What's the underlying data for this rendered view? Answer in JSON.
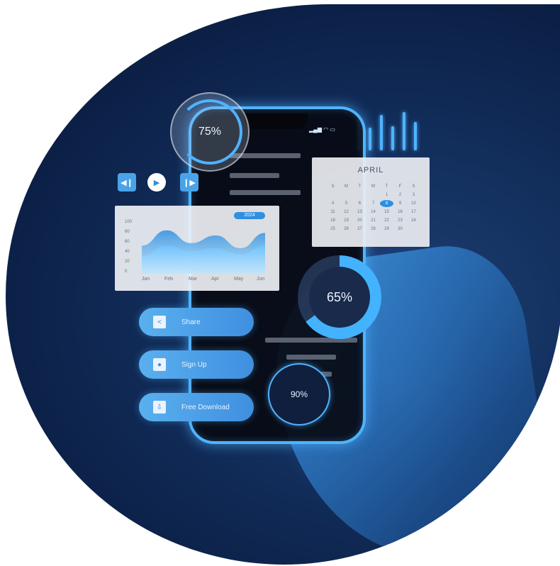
{
  "rings": {
    "r75": "75%",
    "r65": "65%",
    "r90": "90%"
  },
  "progress": {
    "r75": 0.75,
    "r65": 0.65,
    "r90": 0.9
  },
  "media_controls": {
    "prev_icon": "skip-back-icon",
    "play_icon": "play-icon",
    "next_icon": "skip-forward-icon"
  },
  "chart_card": {
    "badge": "2024",
    "y_ticks": [
      "100",
      "80",
      "60",
      "40",
      "20",
      "0"
    ],
    "x_ticks": [
      "Jan",
      "Feb",
      "Mar",
      "Apr",
      "May",
      "Jun"
    ]
  },
  "chart_data": {
    "type": "area",
    "categories": [
      "Jan",
      "Feb",
      "Mar",
      "Apr",
      "May",
      "Jun"
    ],
    "series": [
      {
        "values": [
          55,
          85,
          60,
          75,
          50,
          80
        ]
      },
      {
        "values": [
          35,
          55,
          45,
          50,
          38,
          55
        ]
      }
    ],
    "ylim": [
      0,
      100
    ],
    "title": "",
    "xlabel": "",
    "ylabel": ""
  },
  "calendar": {
    "month": "APRIL",
    "weekdays": [
      "S",
      "M",
      "T",
      "W",
      "T",
      "F",
      "S"
    ],
    "days": [
      "",
      "",
      "",
      "",
      "1",
      "2",
      "3",
      "4",
      "5",
      "6",
      "7",
      "8",
      "9",
      "10",
      "11",
      "12",
      "13",
      "14",
      "15",
      "16",
      "17",
      "18",
      "19",
      "20",
      "21",
      "22",
      "23",
      "24",
      "25",
      "26",
      "27",
      "28",
      "29",
      "30",
      ""
    ],
    "selected": "8"
  },
  "buttons": {
    "share": {
      "label": "Share",
      "icon": "share-icon"
    },
    "signup": {
      "label": "Sign Up",
      "icon": "user-icon"
    },
    "download": {
      "label": "Free Download",
      "icon": "download-icon"
    }
  },
  "colors": {
    "accent": "#4fb3ff",
    "button": "#3f8fe0",
    "background": "#0c2148"
  }
}
